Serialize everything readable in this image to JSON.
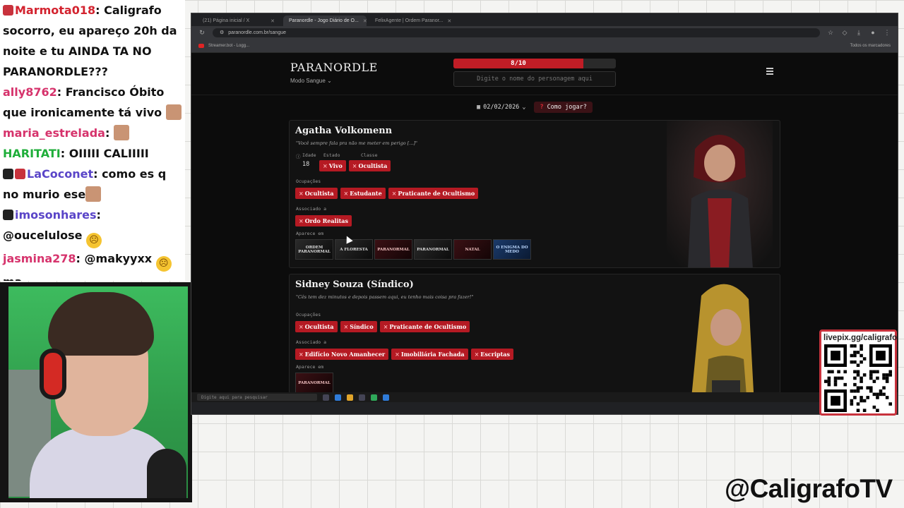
{
  "chat": {
    "messages": [
      {
        "user": "Marmota018",
        "text": "Caligrafo socorro, eu apareço 20h da noite e tu AINDA TA NO PARANORDLE???",
        "emote": ""
      },
      {
        "user": "ally8762",
        "text": "Francisco Óbito que ironicamente tá vivo",
        "emote": "face"
      },
      {
        "user": "maria_estrelada",
        "text": "",
        "emote": "face"
      },
      {
        "user": "HARITATI",
        "text": "OIIIII CALIIIII",
        "emote": ""
      },
      {
        "user": "LaCoconet",
        "text": "como es q no murio ese",
        "emote": "face"
      },
      {
        "user": "imosonhares",
        "text": "@oucelulose",
        "emote": "sad"
      },
      {
        "user": "jasmina278",
        "text": "@makyyxx",
        "emote": "sad",
        "trailing": "ma"
      }
    ]
  },
  "overlay": {
    "qr_label": "livepix.gg/caligrafo",
    "handle": "@CaligrafoTV"
  },
  "browser": {
    "tabs": [
      {
        "title": "(21) Página inicial / X"
      },
      {
        "title": "Paranordle - Jogo Diário de O..."
      },
      {
        "title": "FelixAgente | Ordem Paranor..."
      }
    ],
    "url": "paranordle.com.br/sangue",
    "bookmarks": {
      "item": "Streamer.bot - Logg...",
      "right": "Todos os marcadores"
    }
  },
  "site": {
    "logo": "PARANORDLE",
    "mode": "Modo Sangue",
    "progress": {
      "text": "8/10",
      "fraction": 0.8
    },
    "guess_placeholder": "Digite o nome do personagem aqui",
    "date": "02/02/2026",
    "help_label": "Como jogar?",
    "labels": {
      "age": "Idade",
      "state": "Estado",
      "class": "Classe",
      "occupations": "Ocupações",
      "associated": "Associado a",
      "appears": "Aparece em"
    },
    "cards": [
      {
        "name": "Agatha Volkomenn",
        "quote": "\"Você sempre fala pra não me meter em perigo [...]\"",
        "age": "18",
        "state": "Vivo",
        "class": "Ocultista",
        "occupations": [
          "Ocultista",
          "Estudante",
          "Praticante de Ocultismo"
        ],
        "associated": [
          "Ordo Realitas"
        ],
        "appears": [
          "ORDEM PARANORMAL",
          "A FLORESTA",
          "PARANORMAL",
          "PARANORMAL",
          "NATAL",
          "O ENIGMA DO MEDO"
        ]
      },
      {
        "name": "Sidney Souza (Síndico)",
        "quote": "\"Cês tem dez minutos e depois passem aqui, eu tenho mais coisa pra fazer!\"",
        "occupations": [
          "Ocultista",
          "Síndico",
          "Praticante de Ocultismo"
        ],
        "associated": [
          "Edifício Novo Amanhecer",
          "Imobiliária Fachada",
          "Escriptas"
        ],
        "appears": [
          "PARANORMAL"
        ]
      }
    ]
  },
  "taskbar": {
    "search_placeholder": "Digite aqui para pesquisar"
  },
  "colors": {
    "accent": "#c01d26",
    "chat_bg": "#ffffff",
    "site_bg": "#0c0c0c"
  }
}
